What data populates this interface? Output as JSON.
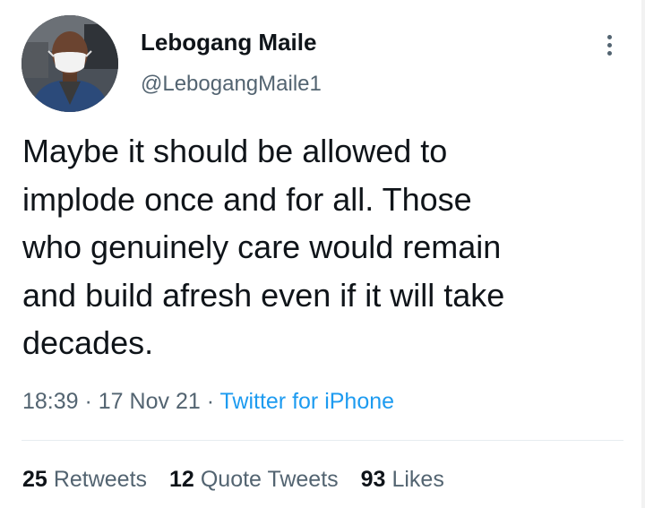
{
  "author": {
    "name": "Lebogang Maile",
    "handle": "@LebogangMaile1"
  },
  "tweet": {
    "text": "Maybe  it should be allowed to\nimplode once and for all. Those\nwho genuinely care would remain\nand build afresh even if it will take\ndecades."
  },
  "meta": {
    "time": "18:39",
    "sep1": " · ",
    "date": "17 Nov 21",
    "sep2": " · ",
    "source": "Twitter for iPhone"
  },
  "stats": {
    "retweets_count": "25",
    "retweets_label": "Retweets",
    "quotes_count": "12",
    "quotes_label": "Quote Tweets",
    "likes_count": "93",
    "likes_label": "Likes"
  },
  "colors": {
    "text": "#0f1419",
    "secondary": "#536471",
    "link": "#1d9bf0"
  },
  "icons": {
    "more": "more-options-icon"
  }
}
